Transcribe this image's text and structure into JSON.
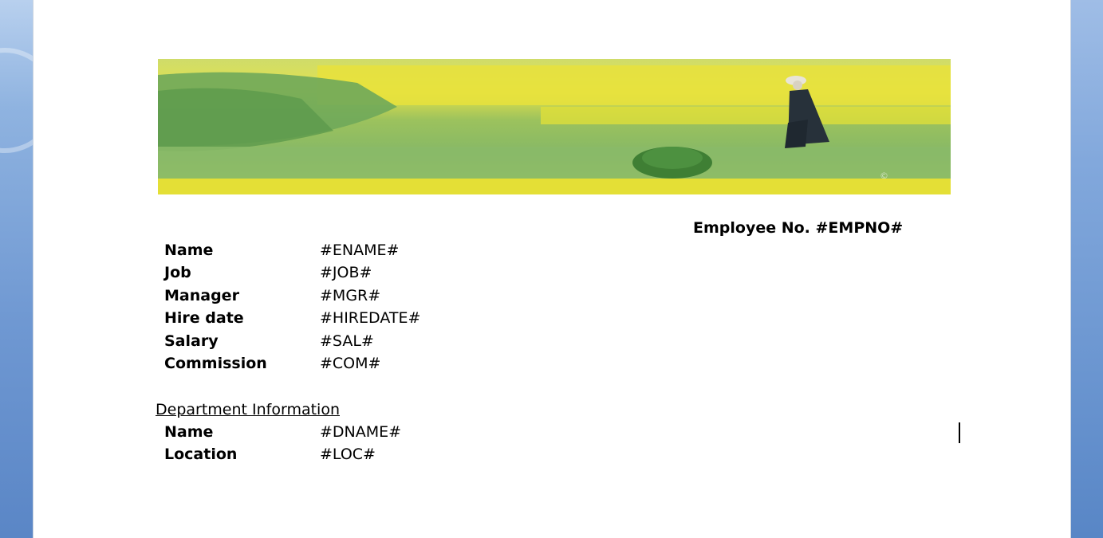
{
  "document": {
    "employee_no_label": "Employee No.",
    "employee_no_value": "#EMPNO#",
    "fields": [
      {
        "label": "Name",
        "value": "#ENAME#"
      },
      {
        "label": "Job",
        "value": "#JOB#"
      },
      {
        "label": "Manager",
        "value": "#MGR#"
      },
      {
        "label": "Hire date",
        "value": "#HIREDATE#"
      },
      {
        "label": "Salary",
        "value": "#SAL#"
      },
      {
        "label": "Commission",
        "value": "#COM#"
      }
    ],
    "department": {
      "heading": "Department Information",
      "fields": [
        {
          "label": "Name",
          "value": "#DNAME#"
        },
        {
          "label": "Location",
          "value": "#LOC#"
        }
      ]
    }
  },
  "banner": {
    "icon": "meadow-photo",
    "colors": {
      "flowers": "#e8e03a",
      "grass": "#7fb35a",
      "dark_grass": "#4f8a3a"
    }
  },
  "colors": {
    "page": "#ffffff",
    "frame": "#7aa3d8",
    "text": "#000000"
  }
}
